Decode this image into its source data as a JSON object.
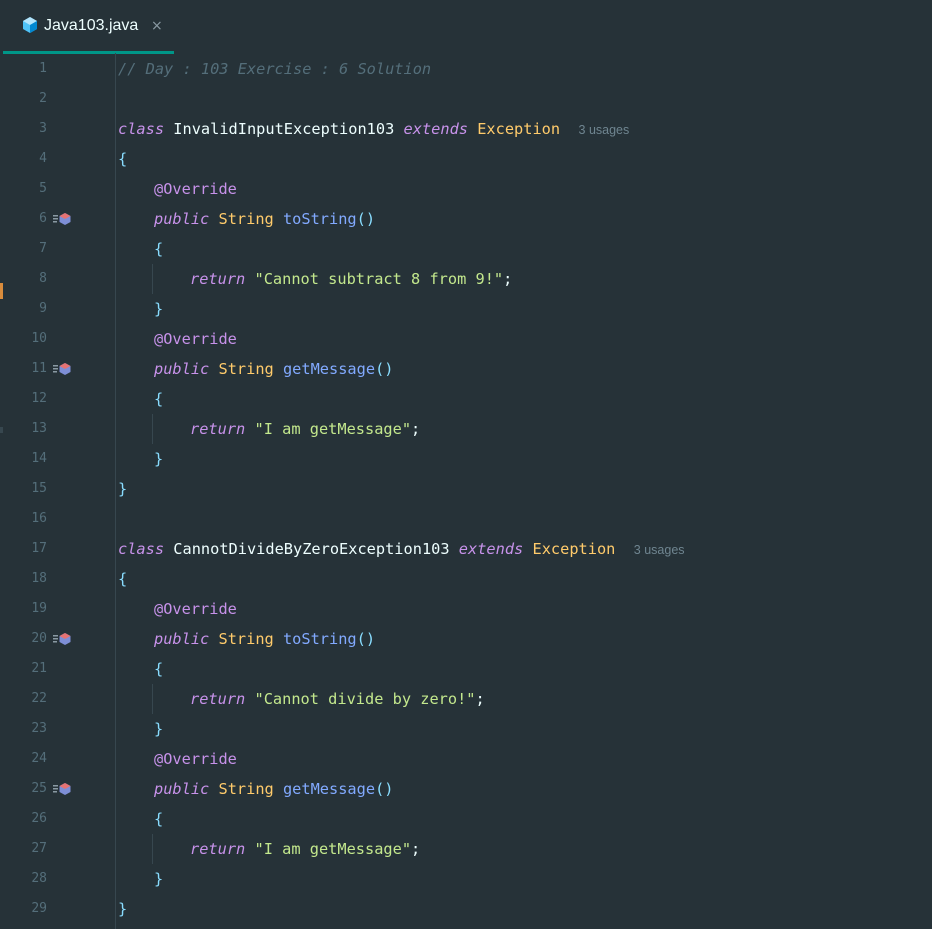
{
  "tab": {
    "icon": "java-file-icon",
    "label": "Java103.java",
    "close": "×"
  },
  "lines": [
    {
      "n": "1",
      "text": "// Day : 103 Exercise : 6 Solution"
    },
    {
      "n": "2"
    },
    {
      "n": "3",
      "kw": "class",
      "name": "InvalidInputException103",
      "ext": "extends",
      "base": "Exception",
      "usages": "3 usages"
    },
    {
      "n": "4",
      "brace": "{"
    },
    {
      "n": "5",
      "anno": "@Override"
    },
    {
      "n": "6",
      "mod": "public",
      "type": "String",
      "method": "toString",
      "parens": "()",
      "marker": true
    },
    {
      "n": "7",
      "brace": "{"
    },
    {
      "n": "8",
      "ret": "return",
      "str": "\"Cannot subtract 8 from 9!\"",
      "semi": ";"
    },
    {
      "n": "9",
      "brace": "}"
    },
    {
      "n": "10",
      "anno": "@Override"
    },
    {
      "n": "11",
      "mod": "public",
      "type": "String",
      "method": "getMessage",
      "parens": "()",
      "marker": true
    },
    {
      "n": "12",
      "brace": "{"
    },
    {
      "n": "13",
      "ret": "return",
      "str": "\"I am getMessage\"",
      "semi": ";"
    },
    {
      "n": "14",
      "brace": "}"
    },
    {
      "n": "15",
      "brace": "}"
    },
    {
      "n": "16"
    },
    {
      "n": "17",
      "kw": "class",
      "name": "CannotDivideByZeroException103",
      "ext": "extends",
      "base": "Exception",
      "usages": "3 usages"
    },
    {
      "n": "18",
      "brace": "{"
    },
    {
      "n": "19",
      "anno": "@Override"
    },
    {
      "n": "20",
      "mod": "public",
      "type": "String",
      "method": "toString",
      "parens": "()",
      "marker": true
    },
    {
      "n": "21",
      "brace": "{"
    },
    {
      "n": "22",
      "ret": "return",
      "str": "\"Cannot divide by zero!\"",
      "semi": ";"
    },
    {
      "n": "23",
      "brace": "}"
    },
    {
      "n": "24",
      "anno": "@Override"
    },
    {
      "n": "25",
      "mod": "public",
      "type": "String",
      "method": "getMessage",
      "parens": "()",
      "marker": true
    },
    {
      "n": "26",
      "brace": "{"
    },
    {
      "n": "27",
      "ret": "return",
      "str": "\"I am getMessage\"",
      "semi": ";"
    },
    {
      "n": "28",
      "brace": "}"
    },
    {
      "n": "29",
      "brace": "}"
    }
  ],
  "colors": {
    "background": "#263238",
    "tab_underline": "#009688",
    "keyword": "#c792ea",
    "class_name": "#ffcb6b",
    "method": "#82aaff",
    "string": "#c3e88d",
    "brace": "#89ddff",
    "comment": "#546e7a"
  }
}
